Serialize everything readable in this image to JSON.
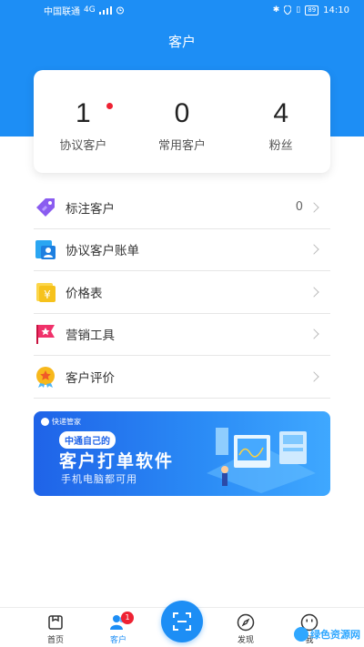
{
  "status_bar": {
    "carrier": "中国联通",
    "network": "4G",
    "battery": "89",
    "time": "14:10"
  },
  "header": {
    "title": "客户"
  },
  "stats": [
    {
      "value": "1",
      "label": "协议客户",
      "has_dot": true
    },
    {
      "value": "0",
      "label": "常用客户",
      "has_dot": false
    },
    {
      "value": "4",
      "label": "粉丝",
      "has_dot": false
    }
  ],
  "menu": [
    {
      "label": "标注客户",
      "count": "0",
      "icon": "tag-icon",
      "color": "#8a5cf0"
    },
    {
      "label": "协议客户账单",
      "count": "",
      "icon": "bill-user-icon",
      "color": "#2aa6f2"
    },
    {
      "label": "价格表",
      "count": "",
      "icon": "price-yuan-icon",
      "color": "#f6c21c"
    },
    {
      "label": "营销工具",
      "count": "",
      "icon": "star-flag-icon",
      "color": "#f0316a"
    },
    {
      "label": "客户评价",
      "count": "",
      "icon": "medal-star-icon",
      "color": "#f7b81c"
    }
  ],
  "banner": {
    "brand": "快递管家",
    "tag": "中通自己的",
    "title": "客户打单软件",
    "subtitle": "手机电脑都可用"
  },
  "tabbar": {
    "items": [
      {
        "label": "首页",
        "icon": "home-icon",
        "active": false
      },
      {
        "label": "客户",
        "icon": "customer-icon",
        "active": true,
        "badge": "1"
      },
      {
        "label": "发现",
        "icon": "compass-icon",
        "active": false
      },
      {
        "label": "我",
        "icon": "me-icon",
        "active": false
      }
    ]
  },
  "watermark": "绿色资源网",
  "colors": {
    "primary": "#1d8ef5",
    "badge_red": "#ee2233"
  }
}
